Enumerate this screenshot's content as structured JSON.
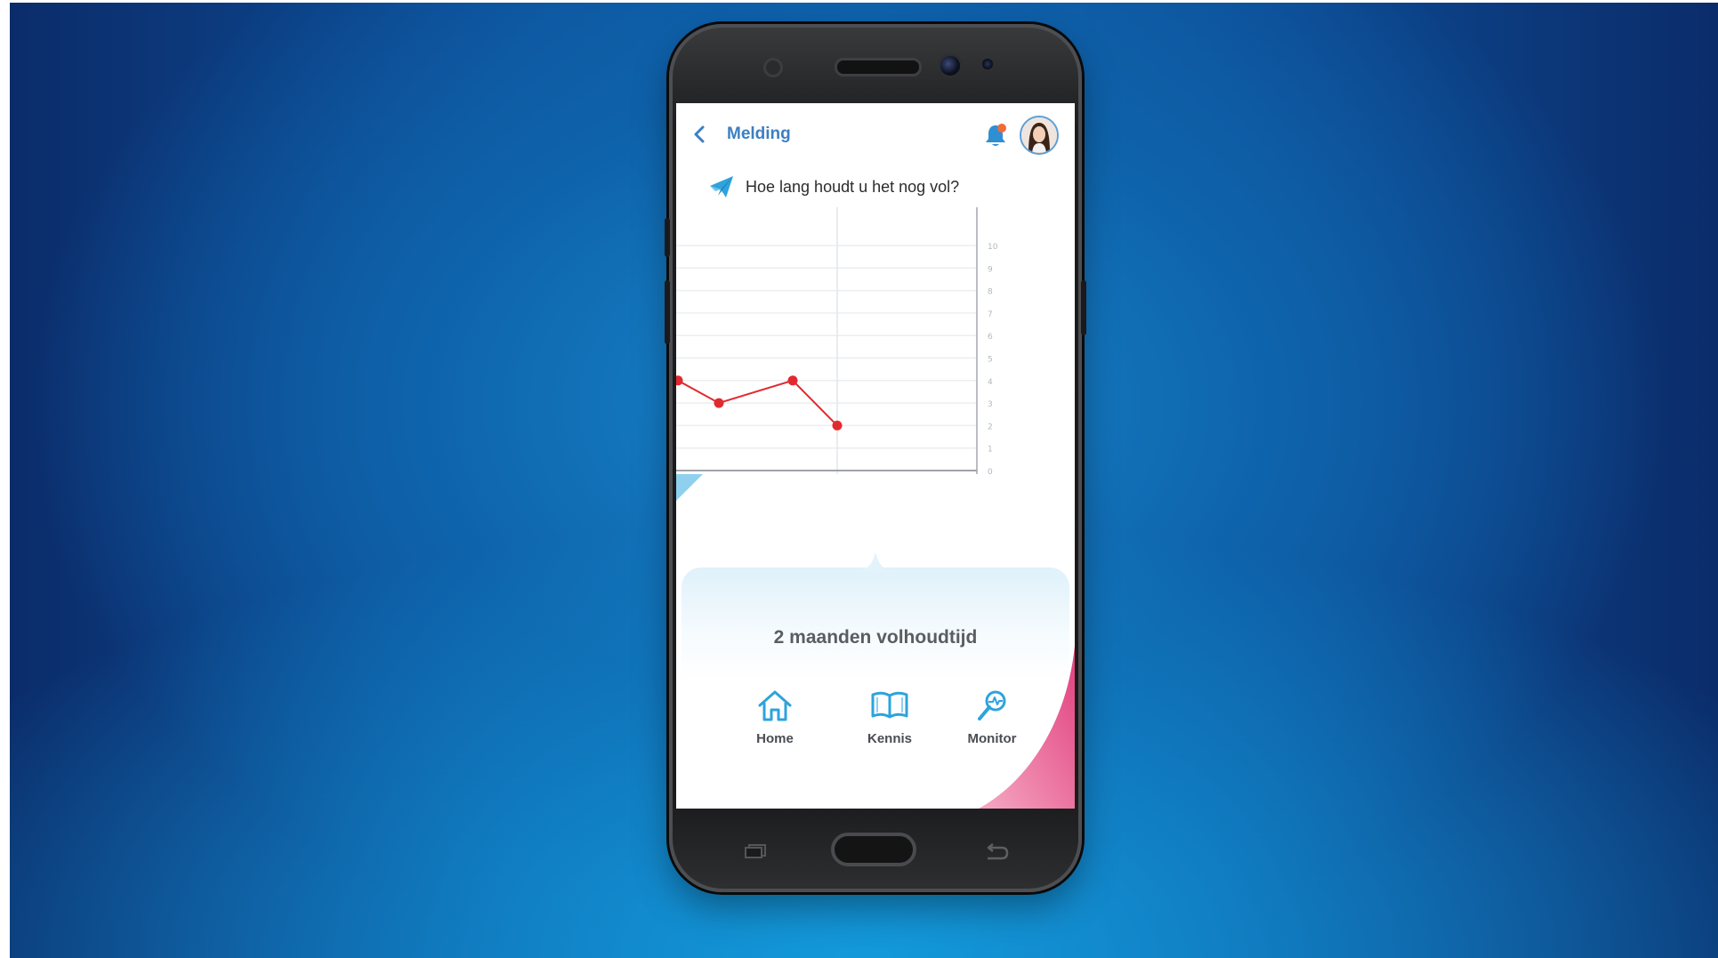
{
  "header": {
    "title": "Melding"
  },
  "question": "Hoe lang houdt u het nog vol?",
  "chart_data": {
    "type": "line",
    "y_ticks": [
      "10",
      "9",
      "8",
      "7",
      "6",
      "5",
      "4",
      "3",
      "2",
      "1",
      "0"
    ],
    "ylim": [
      0,
      10
    ],
    "series": [
      {
        "values": [
          4,
          3,
          4,
          2
        ]
      }
    ],
    "grid": true,
    "color": "#e12a2f"
  },
  "summary": "2 maanden volhoudtijd",
  "nav": [
    {
      "label": "Home",
      "icon": "home-icon"
    },
    {
      "label": "Kennis",
      "icon": "book-icon"
    },
    {
      "label": "Monitor",
      "icon": "monitor-icon"
    }
  ],
  "colors": {
    "accent_blue": "#3d7fc0",
    "icon_blue": "#2ea3dc",
    "line_red": "#e12a2f",
    "pink_accent": "#e0407e"
  }
}
